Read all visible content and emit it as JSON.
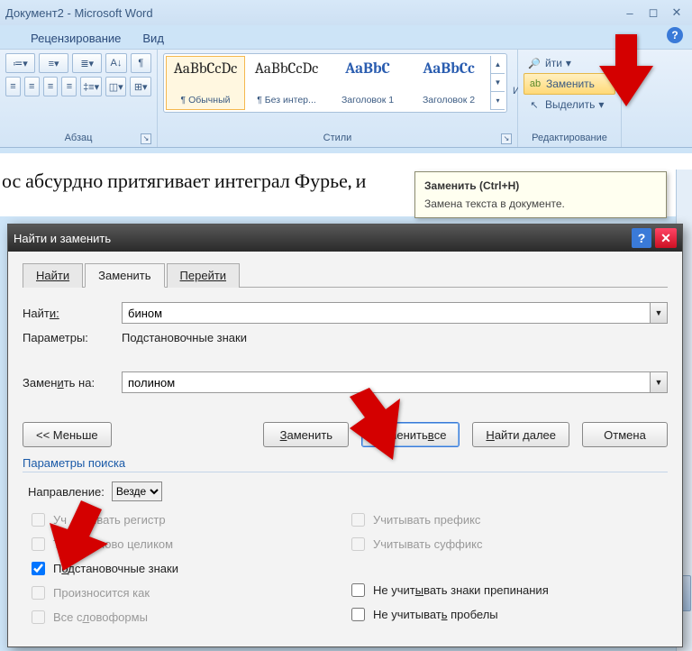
{
  "window": {
    "title": "Документ2 - Microsoft Word"
  },
  "tabs": {
    "review": "Рецензирование",
    "view": "Вид"
  },
  "ribbon": {
    "paragraph_label": "Абзац",
    "styles_label": "Стили",
    "editing_label": "Редактирование",
    "gallery": {
      "preview_normal": "AaBbCcDc",
      "preview_nospace": "AaBbCcDc",
      "preview_h1": "AaBbC",
      "preview_h2": "AaBbCc",
      "name_normal": "¶ Обычный",
      "name_nospace": "¶ Без интер...",
      "name_h1": "Заголовок 1",
      "name_h2": "Заголовок 2"
    },
    "change_styles": "Изменить стили",
    "find": "йти",
    "replace": "Заменить",
    "select": "Выделить"
  },
  "doc": {
    "line1": "ос абсурдно притягивает интеграл Фурье, и"
  },
  "tooltip": {
    "title": "Заменить (Ctrl+H)",
    "body": "Замена текста в документе."
  },
  "dialog": {
    "title": "Найти и заменить",
    "tabs": {
      "find": "Найти",
      "replace": "Заменить",
      "goto": "Перейти"
    },
    "find_label_u": "Найт",
    "find_label_suffix": "и:",
    "find_value": "бином",
    "params_label": "Параметры:",
    "params_value": "Подстановочные знаки",
    "replace_label": "Замен",
    "replace_label_u": "и",
    "replace_label_suffix": "ть на:",
    "replace_value": "полином",
    "btn_less": "<< Меньше",
    "btn_replace": "Заменить",
    "btn_replace_all_pre": "Заменить ",
    "btn_replace_all_u": "в",
    "btn_replace_all_post": "се",
    "btn_find_next": "Найти далее",
    "btn_cancel": "Отмена",
    "search_params": "Параметры поиска",
    "direction_label": "Направление:",
    "direction_value": "Везде",
    "chk_case_pre": "Уч",
    "chk_case_mid": "тывать регистр",
    "chk_whole_pre": "То",
    "chk_whole_mid": "о слово целиком",
    "chk_wildcards_pre": "П",
    "chk_wildcards_u": "о",
    "chk_wildcards_post": "дстановочные знаки",
    "chk_sounds": "Произносится как",
    "chk_wordforms_pre": "Все с",
    "chk_wordforms_u": "л",
    "chk_wordforms_post": "овоформы",
    "chk_prefix": "Учитывать префикс",
    "chk_suffix": "Учитывать суффикс",
    "chk_punct_pre": "Не учит",
    "chk_punct_u": "ы",
    "chk_punct_post": "вать знаки препинания",
    "chk_spaces_pre": "Не учитыват",
    "chk_spaces_u": "ь",
    "chk_spaces_post": " пробелы"
  }
}
